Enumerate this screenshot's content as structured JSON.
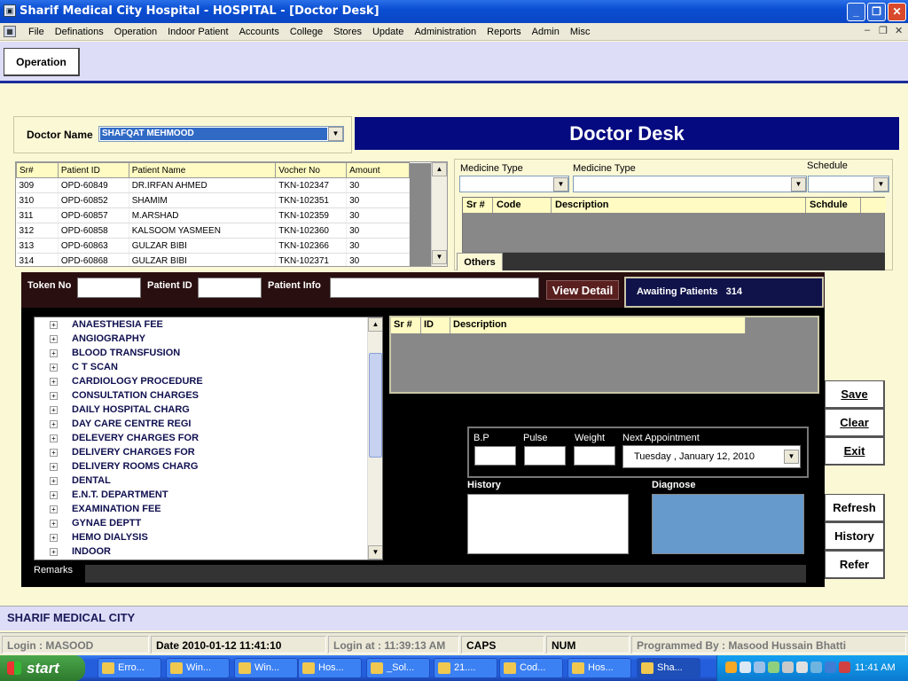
{
  "window": {
    "title": "Sharif Medical City Hospital - HOSPITAL - [Doctor Desk]"
  },
  "menu": [
    "File",
    "Definations",
    "Operation",
    "Indoor Patient",
    "Accounts",
    "College",
    "Stores",
    "Update",
    "Administration",
    "Reports",
    "Admin",
    "Misc"
  ],
  "toolbar": {
    "operation_label": "Operation"
  },
  "doctor": {
    "label": "Doctor Name",
    "value": "SHAFQAT MEHMOOD"
  },
  "banner": "Doctor Desk",
  "patients": {
    "columns": [
      "Sr#",
      "Patient ID",
      "Patient Name",
      "Vocher No",
      "Amount"
    ],
    "rows": [
      [
        "309",
        "OPD-60849",
        "DR.IRFAN AHMED",
        "TKN-102347",
        "30"
      ],
      [
        "310",
        "OPD-60852",
        "SHAMIM",
        "TKN-102351",
        "30"
      ],
      [
        "311",
        "OPD-60857",
        "M.ARSHAD",
        "TKN-102359",
        "30"
      ],
      [
        "312",
        "OPD-60858",
        "KALSOOM YASMEEN",
        "TKN-102360",
        "30"
      ],
      [
        "313",
        "OPD-60863",
        "GULZAR BIBI",
        "TKN-102366",
        "30"
      ],
      [
        "314",
        "OPD-60868",
        "GULZAR BIBI",
        "TKN-102371",
        "30"
      ]
    ]
  },
  "medicine": {
    "type1_label": "Medicine Type",
    "type2_label": "Medicine Type",
    "schedule_label": "Schedule",
    "columns": [
      "Sr #",
      "Code",
      "Description",
      "Schdule"
    ],
    "others_tab": "Others"
  },
  "token": {
    "token_label": "Token No",
    "patient_id_label": "Patient ID",
    "patient_info_label": "Patient Info",
    "view_detail": "View Detail",
    "awaiting_label": "Awaiting Patients",
    "awaiting_count": "314"
  },
  "services": [
    "ANAESTHESIA FEE",
    "ANGIOGRAPHY",
    "BLOOD TRANSFUSION",
    "C T SCAN",
    "CARDIOLOGY PROCEDURE",
    "CONSULTATION CHARGES",
    "DAILY HOSPITAL CHARG",
    "DAY CARE CENTRE REGI",
    "DELEVERY CHARGES FOR",
    "DELIVERY CHARGES FOR",
    "DELIVERY ROOMS CHARG",
    "DENTAL",
    "E.N.T. DEPARTMENT",
    "EXAMINATION FEE",
    "GYNAE DEPTT",
    "HEMO DIALYSIS",
    "INDOOR"
  ],
  "desc_grid": {
    "columns": [
      "Sr #",
      "ID",
      "Description"
    ]
  },
  "vitals": {
    "bp_label": "B.P",
    "pulse_label": "Pulse",
    "weight_label": "Weight",
    "next_label": "Next Appointment",
    "next_value": "Tuesday  ,   January  12, 2010"
  },
  "history_label": "History",
  "diagnose_label": "Diagnose",
  "remarks_label": "Remarks",
  "actions": {
    "save": "Save",
    "clear": "Clear",
    "exit": "Exit",
    "refresh": "Refresh",
    "history": "History",
    "refer": "Refer"
  },
  "footer": {
    "org": "SHARIF MEDICAL CITY"
  },
  "status": {
    "login": "Login :  MASOOD",
    "date": "Date 2010-01-12 11:41:10",
    "login_at": "Login at : 11:39:13 AM",
    "caps": "CAPS",
    "num": "NUM",
    "programmer": "Programmed By : Masood Hussain Bhatti"
  },
  "taskbar": {
    "start": "start",
    "tasks": [
      "Erro...",
      "Win...",
      "Win...",
      "Hos...",
      "_Sol...",
      "21....",
      "Cod...",
      "Hos...",
      "Sha..."
    ],
    "clock": "11:41 AM"
  },
  "colors": {
    "banner": "#050a80",
    "diagnose": "#6699cc",
    "grid_header": "#fffbc2"
  }
}
